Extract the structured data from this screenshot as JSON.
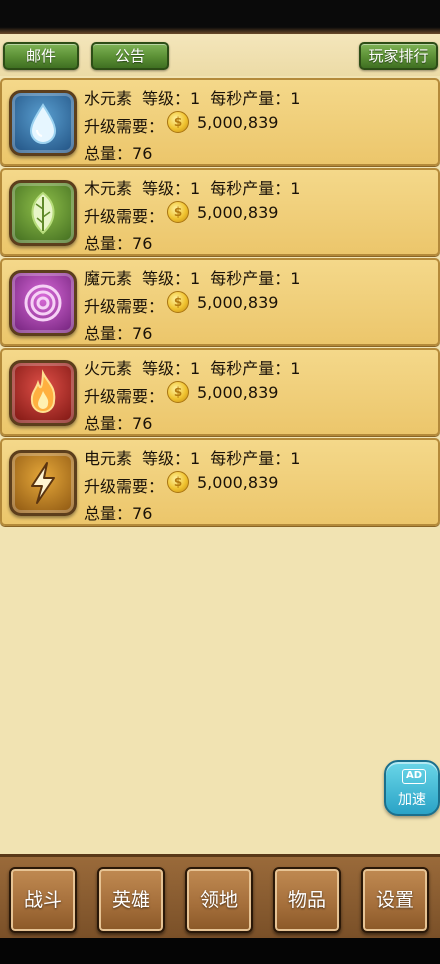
{
  "header": {
    "mail_label": "邮件",
    "notice_label": "公告",
    "rank_label": "玩家排行"
  },
  "elements": [
    {
      "name": "水元素",
      "level_label": "等级：",
      "level": "1",
      "rate_label": "每秒产量：",
      "rate": "1",
      "cost_label": "升级需要：",
      "cost": "5,000,839",
      "total_label": "总量：",
      "total": "76",
      "icon": "water-drop-icon",
      "color": "#2f6fa0"
    },
    {
      "name": "木元素",
      "level_label": "等级：",
      "level": "1",
      "rate_label": "每秒产量：",
      "rate": "1",
      "cost_label": "升级需要：",
      "cost": "5,000,839",
      "total_label": "总量：",
      "total": "76",
      "icon": "leaf-icon",
      "color": "#5f8a2a"
    },
    {
      "name": "魔元素",
      "level_label": "等级：",
      "level": "1",
      "rate_label": "每秒产量：",
      "rate": "1",
      "cost_label": "升级需要：",
      "cost": "5,000,839",
      "total_label": "总量：",
      "total": "76",
      "icon": "spiral-icon",
      "color": "#a23aa8"
    },
    {
      "name": "火元素",
      "level_label": "等级：",
      "level": "1",
      "rate_label": "每秒产量：",
      "rate": "1",
      "cost_label": "升级需要：",
      "cost": "5,000,839",
      "total_label": "总量：",
      "total": "76",
      "icon": "flame-icon",
      "color": "#b02a22"
    },
    {
      "name": "电元素",
      "level_label": "等级：",
      "level": "1",
      "rate_label": "每秒产量：",
      "rate": "1",
      "cost_label": "升级需要：",
      "cost": "5,000,839",
      "total_label": "总量：",
      "total": "76",
      "icon": "lightning-icon",
      "color": "#c98a1e"
    }
  ],
  "coin_symbol": "$",
  "ad": {
    "badge": "AD",
    "label": "加速"
  },
  "nav": {
    "battle": "战斗",
    "hero": "英雄",
    "territory": "领地",
    "items": "物品",
    "settings": "设置"
  }
}
